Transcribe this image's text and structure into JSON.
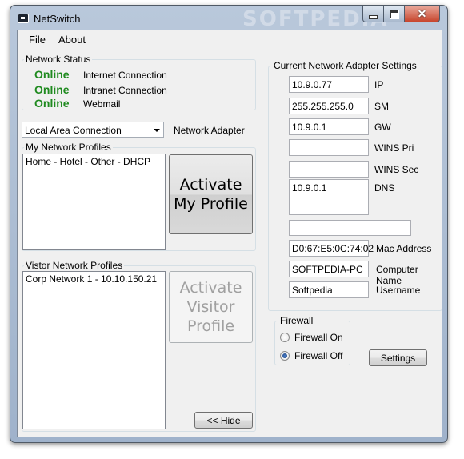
{
  "window": {
    "title": "NetSwitch",
    "watermark": "SOFTPEDIA"
  },
  "menu": {
    "file": "File",
    "about": "About"
  },
  "network_status": {
    "label": "Network Status",
    "items": [
      {
        "status": "Online",
        "name": "Internet Connection"
      },
      {
        "status": "Online",
        "name": "Intranet Connection"
      },
      {
        "status": "Online",
        "name": "Webmail"
      }
    ],
    "status_color": "#1f8a1f"
  },
  "adapter": {
    "selected": "Local Area Connection",
    "label": "Network Adapter"
  },
  "my_profiles": {
    "label": "My Network Profiles",
    "items": [
      "Home - Hotel - Other - DHCP"
    ],
    "button_line1": "Activate",
    "button_line2": "My Profile"
  },
  "visitor_profiles": {
    "label": "Vistor Network Profiles",
    "items": [
      "Corp Network 1 - 10.10.150.21"
    ],
    "button_line1": "Activate",
    "button_line2": "Visitor",
    "button_line3": "Profile"
  },
  "hide_button": "<< Hide",
  "adapter_settings": {
    "label": "Current Network Adapter Settings",
    "ip": {
      "value": "10.9.0.77",
      "label": "IP"
    },
    "sm": {
      "value": "255.255.255.0",
      "label": "SM"
    },
    "gw": {
      "value": "10.9.0.1",
      "label": "GW"
    },
    "wins_pri": {
      "value": "",
      "label": "WINS Pri"
    },
    "wins_sec": {
      "value": "",
      "label": "WINS Sec"
    },
    "dns": {
      "value": "10.9.0.1",
      "label": "DNS"
    },
    "extra": {
      "value": ""
    },
    "mac": {
      "value": "D0:67:E5:0C:74:02",
      "label": "Mac Address"
    },
    "computer": {
      "value": "SOFTPEDIA-PC",
      "label": "Computer Name"
    },
    "username": {
      "value": "Softpedia",
      "label": "Username"
    }
  },
  "firewall": {
    "label": "Firewall",
    "on_label": "Firewall On",
    "off_label": "Firewall Off",
    "selected": "off",
    "settings_button": "Settings"
  }
}
